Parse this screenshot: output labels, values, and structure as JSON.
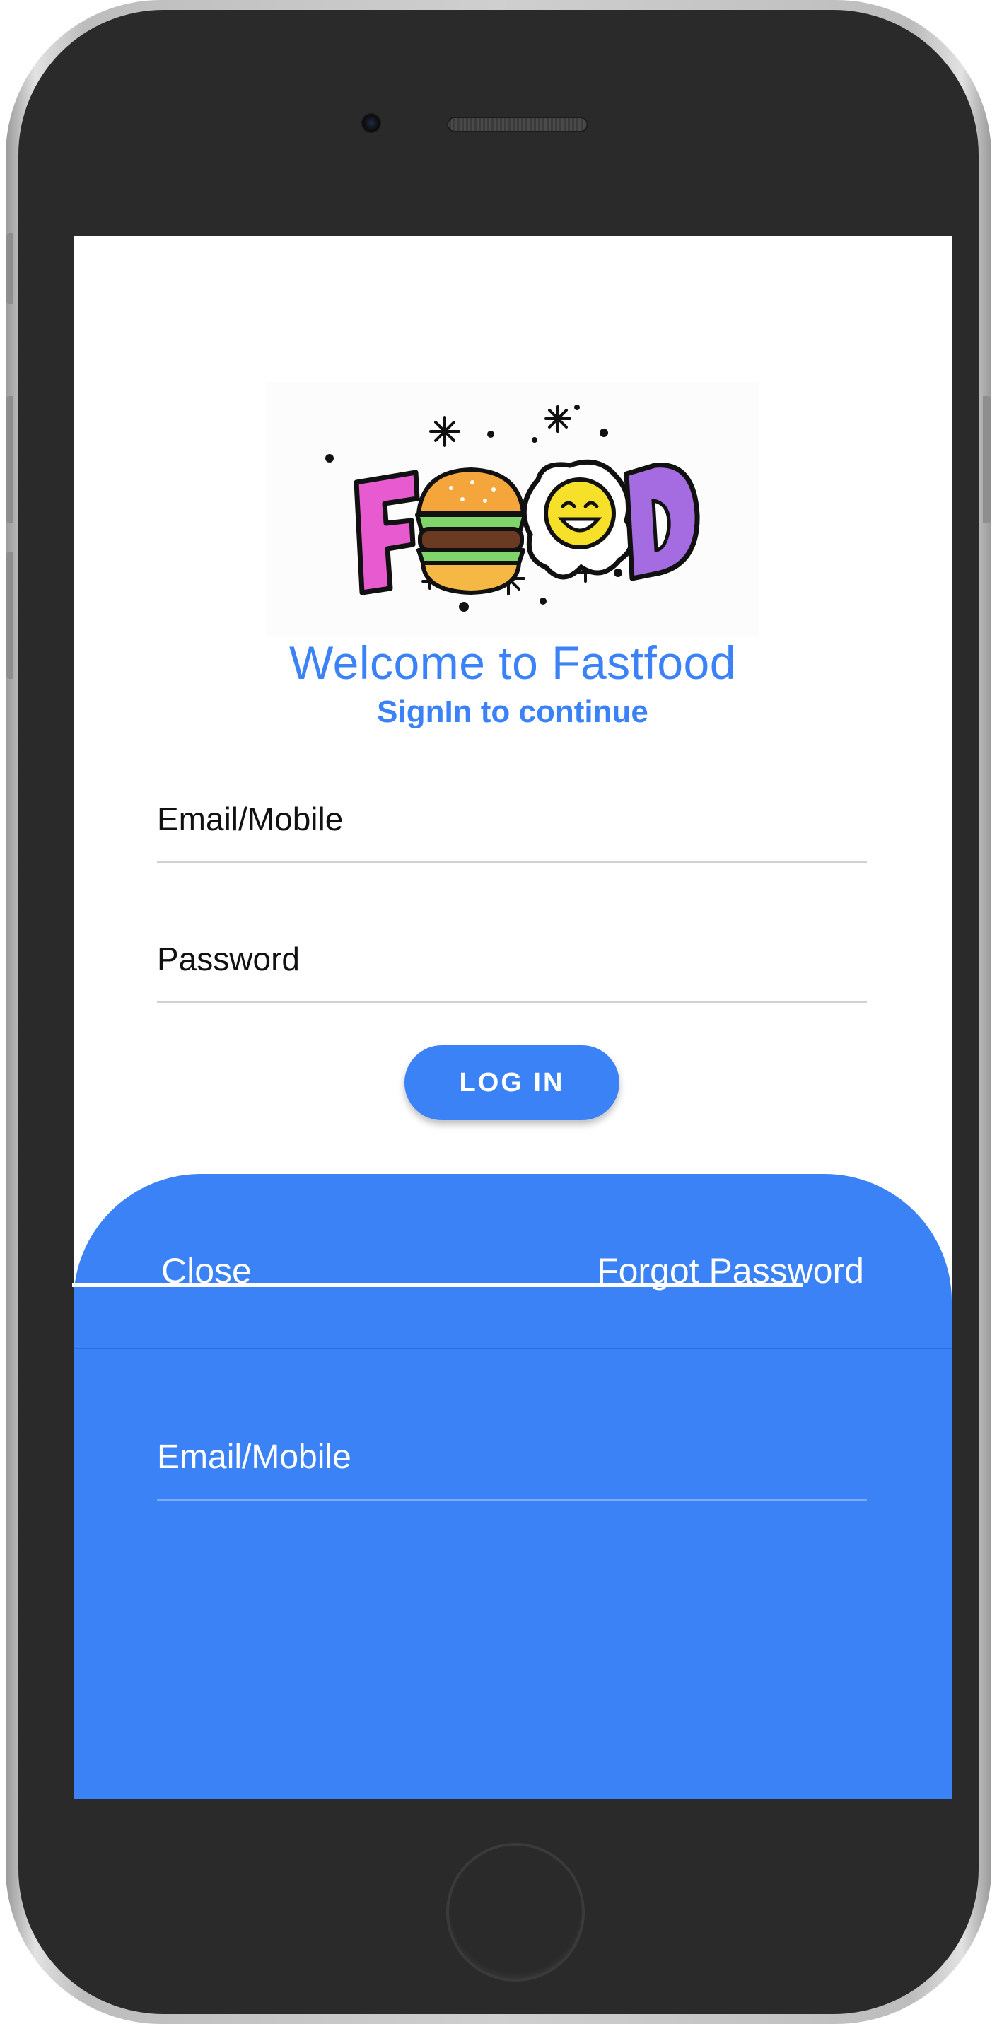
{
  "app": {
    "logo_text": "FOOD",
    "title": "Welcome to Fastfood",
    "subtitle": "SignIn to continue"
  },
  "login_form": {
    "email_placeholder": "Email/Mobile",
    "password_placeholder": "Password",
    "login_label": "LOG IN"
  },
  "forgot_sheet": {
    "close_label": "Close",
    "forgot_label": "Forgot Password",
    "email_placeholder": "Email/Mobile"
  },
  "colors": {
    "accent": "#3b82f6",
    "device_body": "#2a2a2a"
  }
}
